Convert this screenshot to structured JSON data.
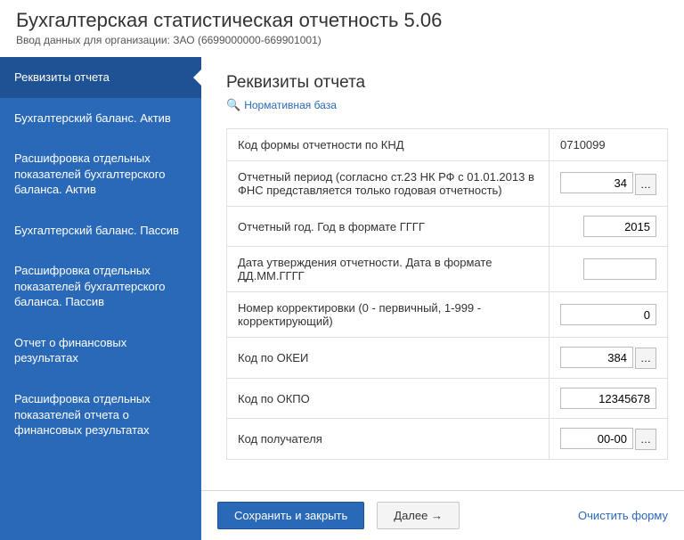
{
  "header": {
    "title": "Бухгалтерская статистическая отчетность 5.06",
    "subtitle": "Ввод данных для организации: ЗАО  (6699000000-669901001)"
  },
  "sidebar": {
    "items": [
      {
        "label": "Реквизиты отчета",
        "active": true
      },
      {
        "label": "Бухгалтерский баланс. Актив"
      },
      {
        "label": "Расшифровка отдельных показателей бухгалтерского баланса. Актив"
      },
      {
        "label": "Бухгалтерский баланс. Пассив"
      },
      {
        "label": "Расшифровка отдельных показателей бухгалтерского баланса. Пассив"
      },
      {
        "label": "Отчет о финансовых результатах"
      },
      {
        "label": "Расшифровка отдельных показателей отчета о финансовых результатах"
      }
    ]
  },
  "main": {
    "title": "Реквизиты отчета",
    "norm_link": "Нормативная база",
    "rows": [
      {
        "label": "Код формы отчетности по КНД",
        "type": "static",
        "value": "0710099"
      },
      {
        "label": "Отчетный период (согласно ст.23 НК РФ с 01.01.2013 в ФНС представляется только годовая отчетность)",
        "type": "picker",
        "value": "34",
        "w": "w80"
      },
      {
        "label": "Отчетный год. Год в формате ГГГГ",
        "type": "input",
        "value": "2015",
        "w": "w80"
      },
      {
        "label": "Дата утверждения отчетности. Дата в формате ДД.ММ.ГГГГ",
        "type": "input",
        "value": "",
        "w": "w80"
      },
      {
        "label": "Номер корректировки (0 - первичный, 1-999 - корректирующий)",
        "type": "input",
        "value": "0",
        "w": "w100"
      },
      {
        "label": "Код по ОКЕИ",
        "type": "picker",
        "value": "384",
        "w": "w80"
      },
      {
        "label": "Код по ОКПО",
        "type": "input",
        "value": "12345678",
        "w": "w100"
      },
      {
        "label": "Код получателя",
        "type": "picker",
        "value": "00-00",
        "w": "w80"
      }
    ]
  },
  "footer": {
    "save": "Сохранить и закрыть",
    "next": "Далее →",
    "clear": "Очистить форму"
  },
  "icons": {
    "ellipsis": "…",
    "search": "🔍"
  }
}
